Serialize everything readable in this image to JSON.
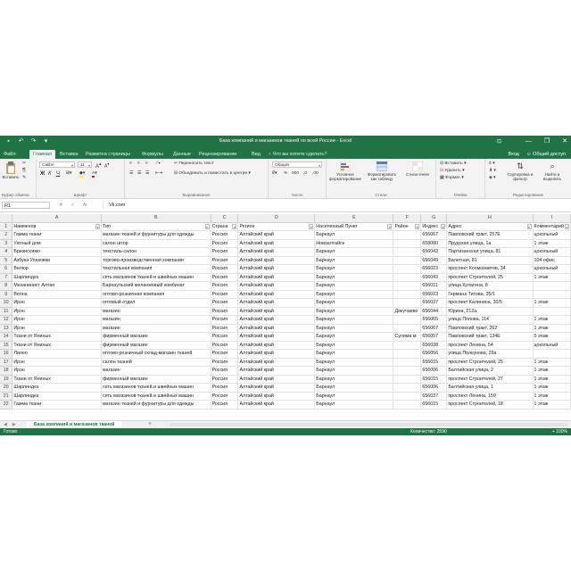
{
  "window": {
    "title": "База компаний и магазинов тканей по всей России - Excel",
    "ribbon_display": "⊡",
    "controls": [
      "—",
      "❐",
      "✕"
    ]
  },
  "tabs": {
    "file": "Файл",
    "items": [
      "Главная",
      "Вставка",
      "Разметка страницы",
      "Формулы",
      "Данные",
      "Рецензирование",
      "Вид",
      "Что вы хотите сделать?"
    ],
    "active_index": 0,
    "login": "Вход",
    "share": "Общий доступ"
  },
  "ribbon": {
    "clipboard": {
      "paste": "Вставить",
      "label": "Буфер обмена"
    },
    "font": {
      "name": "Calibri",
      "size": "11",
      "label": "Шрифт",
      "bold": "Ж",
      "italic": "К",
      "underline": "Ч"
    },
    "alignment": {
      "wrap": "Переносить текст",
      "merge": "Объединить и поместить в центре",
      "label": "Выравнивание"
    },
    "number": {
      "format": "Общий",
      "label": "Число"
    },
    "styles": {
      "conditional": "Условное форматирование",
      "table": "Форматировать как таблицу",
      "cell": "Стили ячеек",
      "label": "Стили"
    },
    "cells": {
      "insert": "Вставить",
      "delete": "Удалить",
      "format": "Формат",
      "label": "Ячейки"
    },
    "editing": {
      "sort": "Сортировка и фильтр",
      "find": "Найти и выделить",
      "label": "Редактирование"
    }
  },
  "formula_bar": {
    "cell_ref": "R1",
    "fx": "fx",
    "value": "Vk.com"
  },
  "grid": {
    "columns": [
      "A",
      "B",
      "C",
      "D",
      "E",
      "F",
      "G",
      "H",
      "I"
    ],
    "header_row": [
      "Наименов",
      "Тип",
      "Страна",
      "Регион",
      "Населенный Пункт",
      "Район",
      "Индекс",
      "Адрес",
      "Комментарий"
    ],
    "rows": [
      [
        "Гамма ткани",
        "магазин тканей и фурнитуры для одежды",
        "Россия",
        "Алтайский край",
        "Барнаул",
        "",
        "656067",
        "Павловский тракт, 257Е",
        "цокольный"
      ],
      [
        "Уютный дом",
        "салон штор",
        "Россия",
        "Алтайский край",
        "Новоалтайск",
        "",
        "658080",
        "Прудская улица, 1а",
        "1 этаж"
      ],
      [
        "Бризиссимо",
        "текстиль-салон",
        "Россия",
        "Алтайский край",
        "Барнаул",
        "",
        "656043",
        "Партизанская улица, 81",
        "цокольный"
      ],
      [
        "Азбука Упаковки",
        "торгово-производственная компания",
        "Россия",
        "Алтайский край",
        "Барнаул",
        "",
        "656049",
        "Балетная, 81",
        "104 офис"
      ],
      [
        "Велюр",
        "текстильная компания",
        "Россия",
        "Алтайский край",
        "Барнаул",
        "",
        "656023",
        "проспект Космонавтов, 34",
        "цокольный"
      ],
      [
        "Шарлиндез",
        "сеть магазинов тканей и швейных машин",
        "Россия",
        "Алтайский край",
        "Барнаул",
        "",
        "656043",
        "проспект Строителей, 25",
        "1 этаж"
      ],
      [
        "Мезанинист Алтая",
        "Барнаульский меланжевый комбинат",
        "Россия",
        "Алтайский край",
        "Барнаул",
        "",
        "656011",
        "улица Кулагина, 8",
        ""
      ],
      [
        "Велна",
        "оптово-розничная компания",
        "Россия",
        "Алтайский край",
        "Барнаул",
        "",
        "656023",
        "Германа Титова, 35/1",
        ""
      ],
      [
        "Ирэн",
        "оптовый отдел",
        "Россия",
        "Алтайский край",
        "Барнаул",
        "",
        "656037",
        "проспект Калинина, 30/5",
        "1 этаж"
      ],
      [
        "Ирэн",
        "магазин",
        "Россия",
        "Алтайский край",
        "Барнаул",
        "Докучаево",
        "656044",
        "Юрина, 212а",
        ""
      ],
      [
        "Ирэн",
        "магазин",
        "Россия",
        "Алтайский край",
        "Барнаул",
        "",
        "656065",
        "улица Попова, 114",
        "1 этаж"
      ],
      [
        "Ирэн",
        "магазин",
        "Россия",
        "Алтайский край",
        "Барнаул",
        "",
        "656067",
        "Павловский тракт, 262",
        "1 этаж"
      ],
      [
        "Ткани от Яниных",
        "фирменный магазин",
        "Россия",
        "Алтайский край",
        "Барнаул",
        "Сулима м",
        "656057",
        "Павловский тракт, 134Е",
        "5 этаж"
      ],
      [
        "Ткани от Яниных",
        "фирменный магазин",
        "Россия",
        "Алтайский край",
        "Барнаул",
        "",
        "656038",
        "проспект Ленина, 54",
        "цокольный"
      ],
      [
        "Лилео",
        "оптово-розничный склад-магазин тканей",
        "Россия",
        "Алтайский край",
        "Барнаул",
        "",
        "656056",
        "улица Полкунова, 29а",
        ""
      ],
      [
        "Ирэн",
        "салон тканей",
        "Россия",
        "Алтайский край",
        "Барнаул",
        "",
        "656015",
        "проспект Строителей, 25",
        "1 этаж"
      ],
      [
        "Ирэн",
        "магазин",
        "Россия",
        "Алтайский край",
        "Барнаул",
        "",
        "656006",
        "Балтийская улица, 2",
        "1 этаж"
      ],
      [
        "Ткани от Яниных",
        "фирменный магазин",
        "Россия",
        "Алтайский край",
        "Барнаул",
        "",
        "656015",
        "проспект Строителей, 27",
        "1 этаж"
      ],
      [
        "Шарлиндез",
        "сеть магазинов тканей и швейных машин",
        "Россия",
        "Алтайский край",
        "Барнаул",
        "",
        "656006",
        "Балтийская улица, 1",
        "1 этаж"
      ],
      [
        "Шарлиндез",
        "сеть магазинов тканей и швейных машин",
        "Россия",
        "Алтайский край",
        "Барнаул",
        "",
        "656037",
        "проспект Ленина, 159",
        "1 этаж"
      ],
      [
        "Гамма ткани",
        "магазин тканей и фурнитуры для одежды",
        "Россия",
        "Алтайский край",
        "Барнаул",
        "",
        "656015",
        "проспект Строителей, 18",
        "1 этаж"
      ]
    ]
  },
  "sheet_tab": {
    "name": "База компаний и магазинов тканей",
    "add": "+"
  },
  "status": {
    "left": "Готово",
    "center": "Количество: 2590",
    "right": "+ 100%"
  }
}
